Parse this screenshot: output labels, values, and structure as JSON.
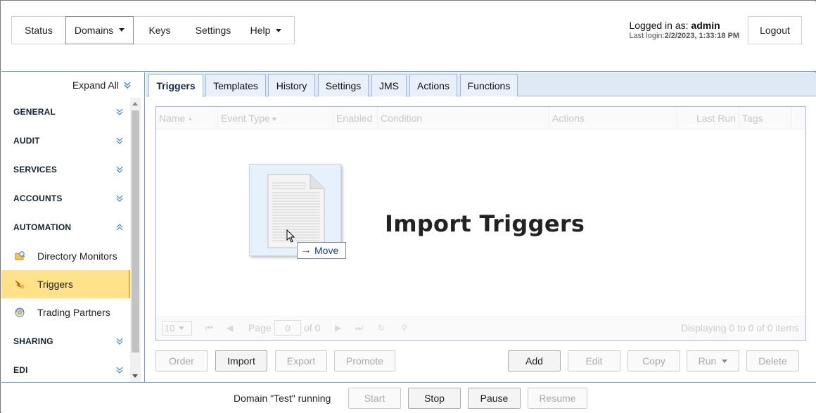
{
  "nav": {
    "items": [
      {
        "label": "Status",
        "active": false,
        "dropdown": false
      },
      {
        "label": "Domains",
        "active": true,
        "dropdown": true
      },
      {
        "label": "Keys",
        "active": false,
        "dropdown": false
      },
      {
        "label": "Settings",
        "active": false,
        "dropdown": false
      },
      {
        "label": "Help",
        "active": false,
        "dropdown": true
      }
    ]
  },
  "login": {
    "prefix": "Logged in as: ",
    "user": "admin",
    "last_login_prefix": "Last login:",
    "last_login_value": "2/2/2023, 1:33:18 PM",
    "logout_label": "Logout"
  },
  "sidebar": {
    "expand_all_label": "Expand All",
    "sections": [
      {
        "label": "GENERAL",
        "expanded": false
      },
      {
        "label": "AUDIT",
        "expanded": false
      },
      {
        "label": "SERVICES",
        "expanded": false
      },
      {
        "label": "ACCOUNTS",
        "expanded": false
      },
      {
        "label": "AUTOMATION",
        "expanded": true
      },
      {
        "label": "SHARING",
        "expanded": false
      },
      {
        "label": "EDI",
        "expanded": false
      }
    ],
    "automation_items": [
      {
        "label": "Directory Monitors",
        "icon": "directory-monitor-icon",
        "selected": false
      },
      {
        "label": "Triggers",
        "icon": "trigger-icon",
        "selected": true
      },
      {
        "label": "Trading Partners",
        "icon": "trading-partner-icon",
        "selected": false
      }
    ]
  },
  "tabs": [
    {
      "label": "Triggers",
      "active": true
    },
    {
      "label": "Templates",
      "active": false
    },
    {
      "label": "History",
      "active": false
    },
    {
      "label": "Settings",
      "active": false
    },
    {
      "label": "JMS",
      "active": false
    },
    {
      "label": "Actions",
      "active": false
    },
    {
      "label": "Functions",
      "active": false
    }
  ],
  "grid": {
    "columns": [
      "Name",
      "Event Type",
      "Enabled",
      "Condition",
      "Actions",
      "Last Run",
      "Tags"
    ],
    "pager": {
      "page_size": "10",
      "page_label": "Page",
      "page_value": "0",
      "of_label": "of 0",
      "display_text": "Displaying 0 to 0 of 0 items"
    }
  },
  "drag_overlay": {
    "title": "Import Triggers",
    "move_label": "Move"
  },
  "buttons": {
    "order": "Order",
    "import": "Import",
    "export": "Export",
    "promote": "Promote",
    "add": "Add",
    "edit": "Edit",
    "copy": "Copy",
    "run": "Run",
    "delete": "Delete"
  },
  "statusbar": {
    "text": "Domain \"Test\" running",
    "start": "Start",
    "stop": "Stop",
    "pause": "Pause",
    "resume": "Resume"
  },
  "colors": {
    "accent_border": "#6aa0d8",
    "tab_bg": "#dfe9f5",
    "selected_item": "#ffe28a"
  }
}
